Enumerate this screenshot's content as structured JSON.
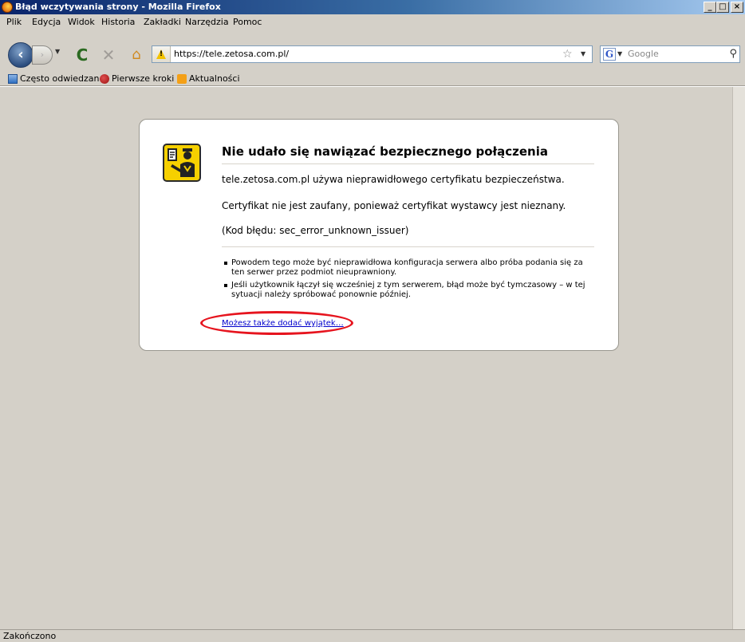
{
  "window": {
    "title": "Błąd wczytywania strony - Mozilla Firefox",
    "controls": {
      "minimize": "_",
      "maximize": "□",
      "close": "×"
    }
  },
  "menu": [
    "Plik",
    "Edycja",
    "Widok",
    "Historia",
    "Zakładki",
    "Narzędzia",
    "Pomoc"
  ],
  "toolbar": {
    "back": "‹",
    "forward": "›",
    "reload": "C",
    "stop": "✕",
    "home": "⌂",
    "url": "https://tele.zetosa.com.pl/",
    "bookmark_star": "☆",
    "dropdown": "▼",
    "search_engine_badge": "G",
    "search_placeholder": "Google",
    "search_button": "⚲"
  },
  "bookmarks": [
    {
      "label": "Często odwiedzane",
      "icon": "frequent-icon"
    },
    {
      "label": "Pierwsze kroki",
      "icon": "firefox-getting-started-icon"
    },
    {
      "label": "Aktualności",
      "icon": "rss-feed-icon"
    }
  ],
  "error": {
    "title": "Nie udało się nawiązać bezpiecznego połączenia",
    "line1": "tele.zetosa.com.pl używa nieprawidłowego certyfikatu bezpieczeństwa.",
    "line2": "Certyfikat nie jest zaufany, ponieważ certyfikat wystawcy jest nieznany.",
    "line3": "(Kod błędu: sec_error_unknown_issuer)",
    "bullets": [
      "Powodem tego może być nieprawidłowa konfiguracja serwera albo próba podania się za ten serwer przez podmiot nieuprawniony.",
      "Jeśli użytkownik łączył się wcześniej z tym serwerem, błąd może być tymczasowy – w tej sytuacji należy spróbować ponownie później."
    ],
    "add_exception": "Możesz także dodać wyjątek…",
    "icon": "security-officer-icon"
  },
  "status": "Zakończono",
  "colors": {
    "highlight_ring": "#e6141e",
    "link": "#0000cc",
    "icon_yellow": "#f6d000"
  }
}
